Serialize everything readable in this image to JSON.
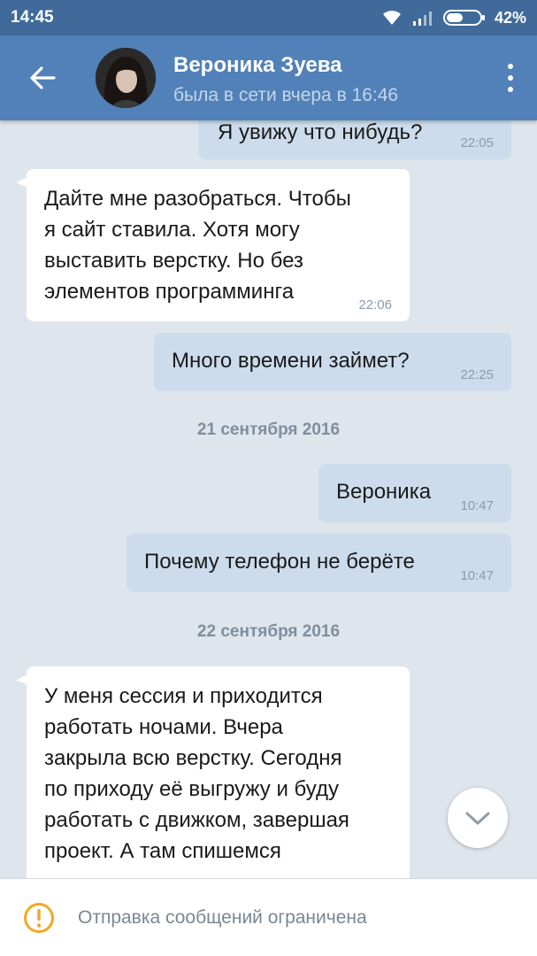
{
  "status_bar": {
    "time": "14:45",
    "battery": "42%",
    "icons": [
      "wifi-icon",
      "signal-icon",
      "battery-icon"
    ]
  },
  "header": {
    "contact_name": "Вероника Зуева",
    "contact_status": "была в сети вчера в 16:46",
    "icons": [
      "back-arrow-icon",
      "avatar",
      "more-vert-icon"
    ]
  },
  "messages": [
    {
      "direction": "out",
      "text": "Я увижу что нибудь?",
      "time": "22:05"
    },
    {
      "direction": "in",
      "text": "Дайте мне разобраться. Чтобы\nя сайт ставила. Хотя могу\nвыставить верстку. Но без\nэлементов программинга",
      "time": "22:06"
    },
    {
      "direction": "out",
      "text": "Много времени займет?",
      "time": "22:25"
    },
    {
      "direction": "out",
      "text": "Вероника",
      "time": "10:47"
    },
    {
      "direction": "out",
      "text": "Почему телефон не берёте",
      "time": "10:47"
    },
    {
      "direction": "in",
      "text": "У меня сессия и приходится\nработать ночами. Вчера\nзакрыла всю верстку. Сегодня\nпо приходу её выгружу и буду\nработать с движком, завершая\nпроект. А там спишемся",
      "time": ""
    }
  ],
  "date_separators": [
    "21 сентября 2016",
    "22 сентября 2016"
  ],
  "footer": {
    "notice": "Отправка сообщений ограничена",
    "icon": "warning-icon"
  },
  "colors": {
    "header": "#5181b8",
    "status_bar": "#3f6a9a",
    "outgoing_bubble": "#cddcec",
    "incoming_bubble": "#ffffff",
    "background": "#dfe5ec",
    "warning": "#f5a623"
  }
}
